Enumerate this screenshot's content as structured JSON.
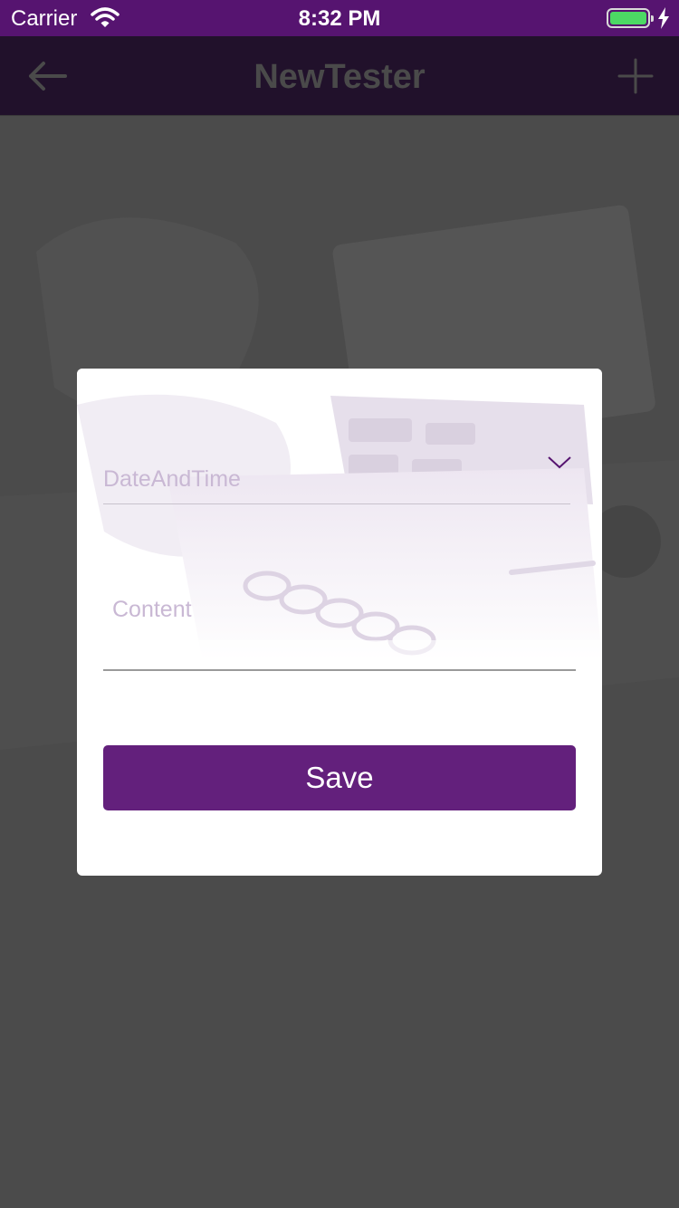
{
  "status_bar": {
    "carrier": "Carrier",
    "time": "8:32 PM"
  },
  "nav": {
    "title": "NewTester",
    "back_icon": "arrow-left-icon",
    "add_icon": "plus-icon"
  },
  "dialog": {
    "date_field": {
      "placeholder": "DateAndTime",
      "icon": "chevron-down-icon"
    },
    "content_field": {
      "placeholder": "Content"
    },
    "save_label": "Save"
  },
  "colors": {
    "status_bar": "#561470",
    "nav_bar": "#21112b",
    "overlay": "#4b4b4b",
    "primary_button": "#63207c",
    "placeholder": "#c9b8d4"
  }
}
